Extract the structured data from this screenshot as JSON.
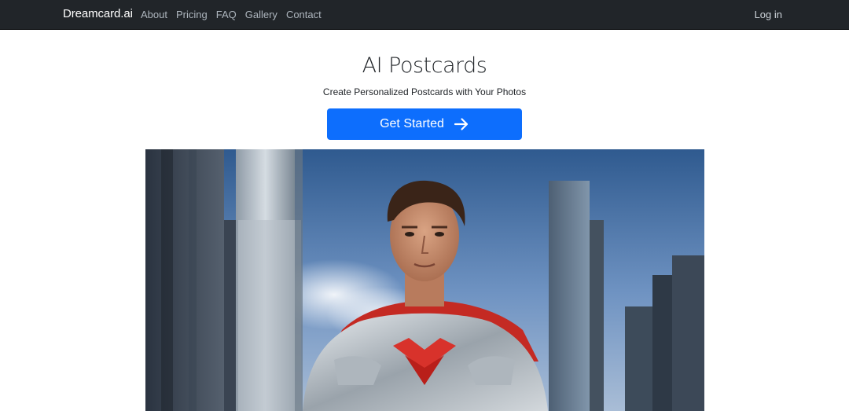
{
  "nav": {
    "brand": "Dreamcard.ai",
    "links": [
      "About",
      "Pricing",
      "FAQ",
      "Gallery",
      "Contact"
    ],
    "login": "Log in"
  },
  "hero": {
    "title": "AI Postcards",
    "subtitle": "Create Personalized Postcards with Your Photos",
    "cta_label": "Get Started",
    "cta_icon": "arrow-right-icon",
    "image_alt": "superhero-man-in-silver-armor-with-red-cape-city-skyline"
  },
  "colors": {
    "navbar_bg": "#212529",
    "primary": "#0d6efd"
  }
}
